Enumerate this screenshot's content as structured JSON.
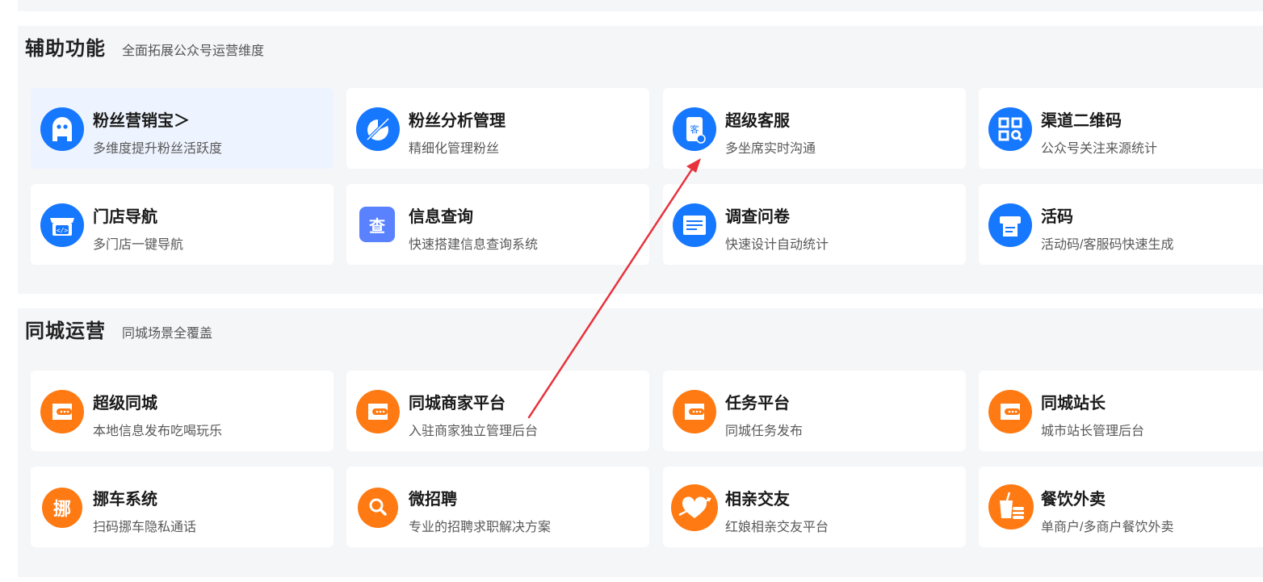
{
  "sections": [
    {
      "title": "辅助功能",
      "subtitle": "全面拓展公众号运营维度",
      "items": [
        {
          "name": "粉丝营销宝＞",
          "desc": "多维度提升粉丝活跃度",
          "icon": "robot-icon"
        },
        {
          "name": "粉丝分析管理",
          "desc": "精细化管理粉丝",
          "icon": "pie-chart-icon"
        },
        {
          "name": "超级客服",
          "desc": "多坐席实时沟通",
          "icon": "customer-service-icon"
        },
        {
          "name": "渠道二维码",
          "desc": "公众号关注来源统计",
          "icon": "qr-code-icon"
        },
        {
          "name": "门店导航",
          "desc": "多门店一键导航",
          "icon": "store-icon"
        },
        {
          "name": "信息查询",
          "desc": "快速搭建信息查询系统",
          "icon": "query-icon",
          "icon_text": "查"
        },
        {
          "name": "调查问卷",
          "desc": "快速设计自动统计",
          "icon": "survey-icon"
        },
        {
          "name": "活码",
          "desc": "活动码/客服码快速生成",
          "icon": "printer-icon"
        }
      ]
    },
    {
      "title": "同城运营",
      "subtitle": "同城场景全覆盖",
      "items": [
        {
          "name": "超级同城",
          "desc": "本地信息发布吃喝玩乐",
          "icon": "chat-card-icon"
        },
        {
          "name": "同城商家平台",
          "desc": "入驻商家独立管理后台",
          "icon": "chat-card-icon"
        },
        {
          "name": "任务平台",
          "desc": "同城任务发布",
          "icon": "chat-card-icon"
        },
        {
          "name": "同城站长",
          "desc": "城市站长管理后台",
          "icon": "chat-card-icon"
        },
        {
          "name": "挪车系统",
          "desc": "扫码挪车隐私通话",
          "icon": "move-car-icon",
          "icon_text": "挪"
        },
        {
          "name": "微招聘",
          "desc": "专业的招聘求职解决方案",
          "icon": "search-icon"
        },
        {
          "name": "相亲交友",
          "desc": "红娘相亲交友平台",
          "icon": "heart-arrow-icon"
        },
        {
          "name": "餐饮外卖",
          "desc": "单商户/多商户餐饮外卖",
          "icon": "food-delivery-icon"
        }
      ]
    }
  ],
  "colors": {
    "blue": "#1677ff",
    "orange": "#ff7a12",
    "arrow": "#e8323c"
  }
}
